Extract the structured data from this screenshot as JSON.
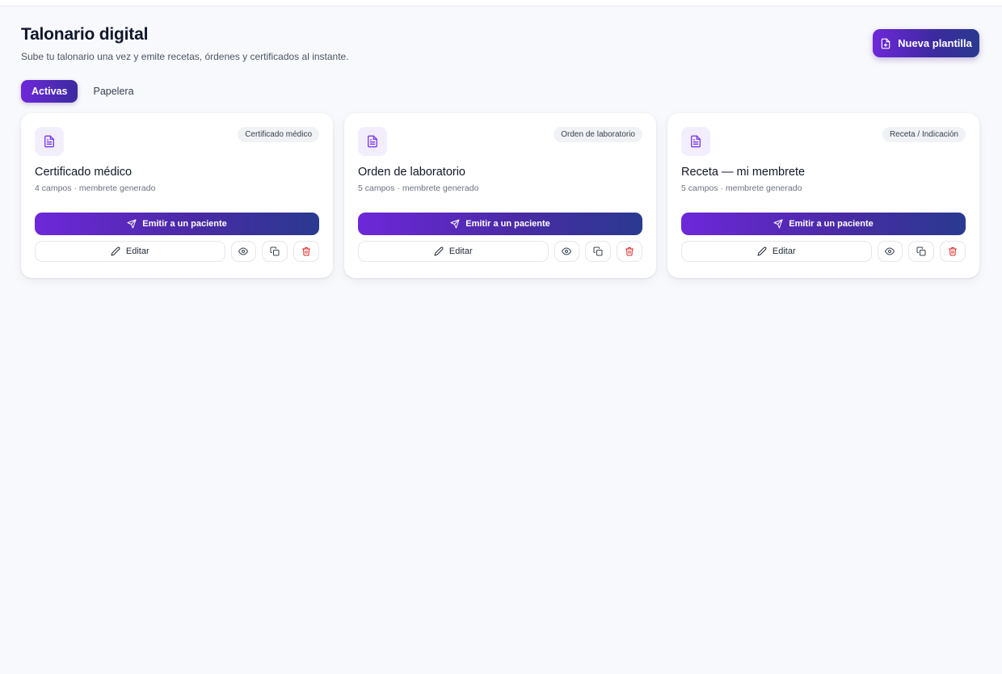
{
  "header": {
    "title": "Talonario digital",
    "subtitle": "Sube tu talonario una vez y emite recetas, órdenes y certificados al instante.",
    "new_button_label": "Nueva plantilla",
    "new_button_icon": "file-plus-icon"
  },
  "tabs": [
    {
      "label": "Activas",
      "active": true
    },
    {
      "label": "Papelera",
      "active": false
    }
  ],
  "cards": [
    {
      "icon": "document-icon",
      "badge": "Certificado médico",
      "title": "Certificado médico",
      "meta": "4 campos · membrete generado",
      "emit_label": "Emitir a un paciente",
      "edit_label": "Editar"
    },
    {
      "icon": "document-icon",
      "badge": "Orden de laboratorio",
      "title": "Orden de laboratorio",
      "meta": "5 campos · membrete generado",
      "emit_label": "Emitir a un paciente",
      "edit_label": "Editar"
    },
    {
      "icon": "document-icon",
      "badge": "Receta / Indicación",
      "title": "Receta — mi membrete",
      "meta": "5 campos · membrete generado",
      "emit_label": "Emitir a un paciente",
      "edit_label": "Editar"
    }
  ],
  "colors": {
    "accent_start": "#6d28d9",
    "accent_end": "#2a3a8f",
    "icon_bg": "#f3eefe",
    "icon_color": "#7c3aed",
    "danger": "#dc2626",
    "background": "#f8f9fc"
  }
}
